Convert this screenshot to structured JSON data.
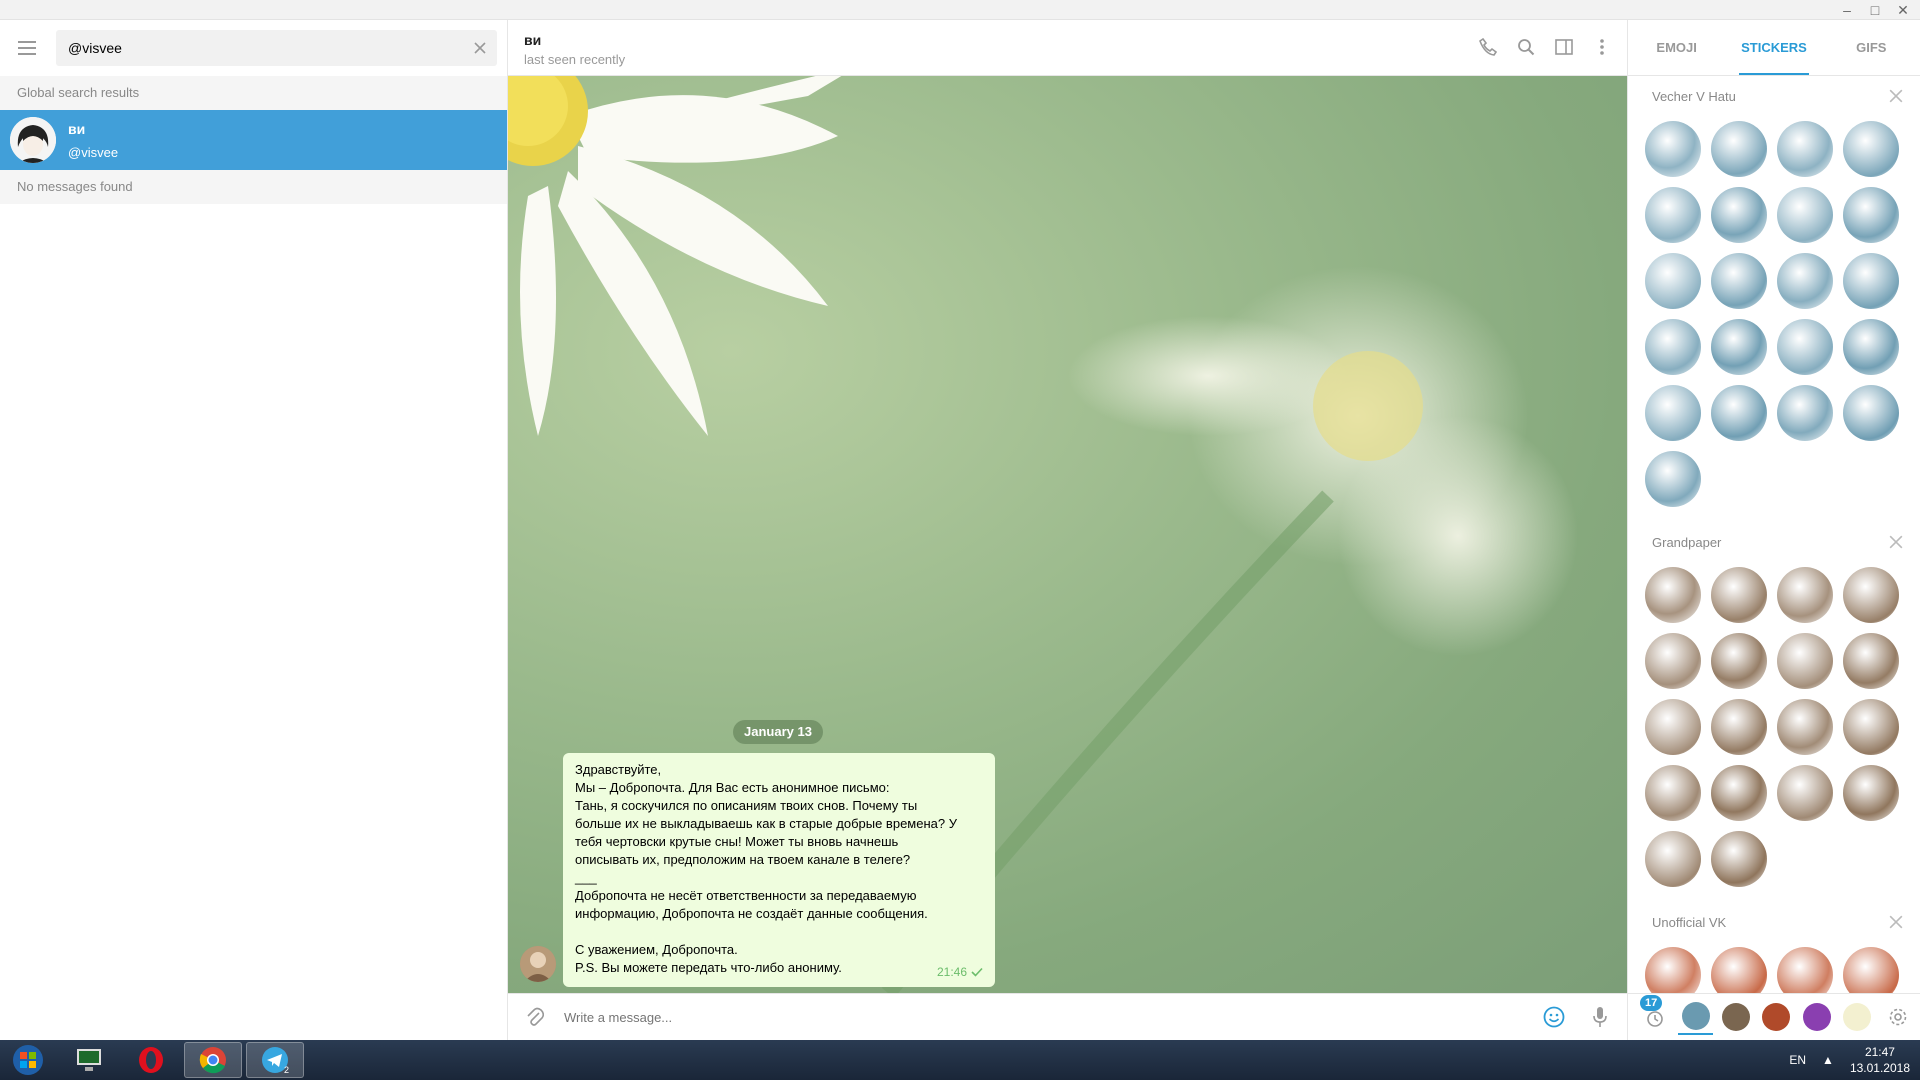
{
  "window": {
    "minimize": "–",
    "maximize": "□",
    "close": "✕"
  },
  "left": {
    "search_value": "@visvee",
    "global_results_label": "Global search results",
    "result": {
      "name": "ви",
      "username": "@visvee"
    },
    "no_messages_label": "No messages found"
  },
  "chat": {
    "name": "ви",
    "status": "last seen recently",
    "date_label": "January 13",
    "message_lines": [
      "Здравствуйте,",
      "Мы – Добропочта. Для Вас есть анонимное письмо:",
      "Тань, я соскучился по описаниям твоих снов. Почему ты",
      "больше их не выкладываешь как в старые добрые времена? У",
      "тебя чертовски крутые сны! Может ты вновь начнешь",
      "описывать их, предположим на твоем канале в телеге?",
      "___",
      "Добропочта не несёт ответственности за передаваемую",
      "информацию, Добропочта не создаёт данные сообщения.",
      "",
      "С уважением, Добропочта.",
      "P.S. Вы можете передать что-либо анониму."
    ],
    "message_time": "21:46",
    "composer_placeholder": "Write a message..."
  },
  "panel": {
    "tabs": [
      "EMOJI",
      "STICKERS",
      "GIFS"
    ],
    "active_tab": "STICKERS",
    "sets": [
      {
        "title": "Vecher V Hatu",
        "count": 21,
        "color": "#6a9ab0"
      },
      {
        "title": "Grandpaper",
        "count": 18,
        "color": "#8a6f55"
      },
      {
        "title": "Unofficial VK",
        "count": 4,
        "color": "#c0552f"
      }
    ],
    "footer_badge": "17"
  },
  "taskbar": {
    "lang": "EN",
    "time": "21:47",
    "date": "13.01.2018",
    "telegram_count": "2"
  }
}
